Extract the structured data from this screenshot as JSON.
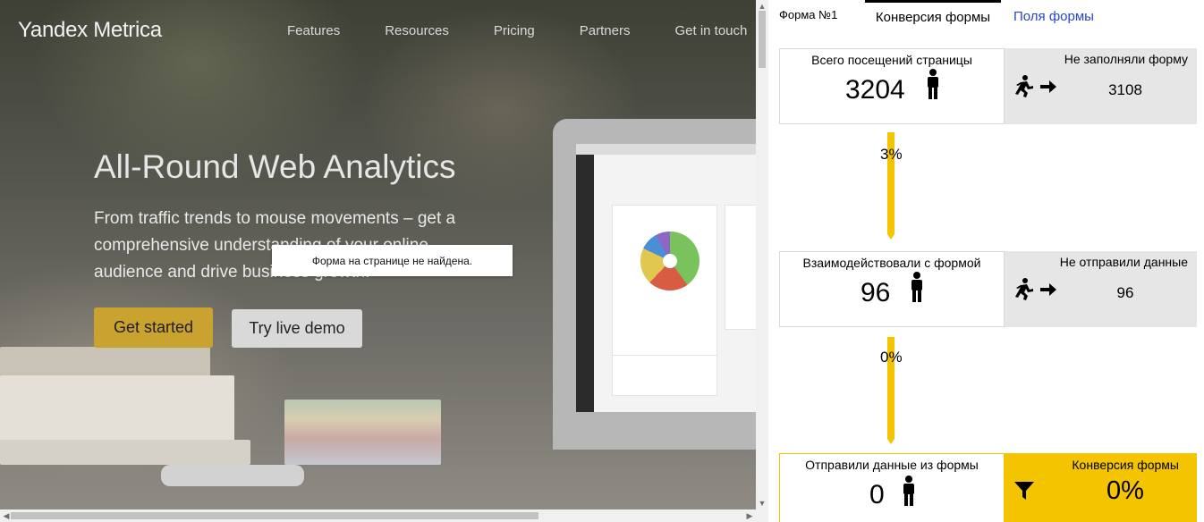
{
  "site": {
    "logo_brand": "Yandex",
    "logo_product": "Metrica",
    "nav": [
      "Features",
      "Resources",
      "Pricing",
      "Partners",
      "Get in touch"
    ],
    "hero_title": "All-Round Web Analytics",
    "hero_subtitle": "From traffic trends to mouse movements – get a comprehensive understanding of your online audience and drive business growth.",
    "get_started": "Get started",
    "try_demo": "Try live demo",
    "notice": "Форма на странице не найдена."
  },
  "panel": {
    "form_name": "Форма №1",
    "tab_active": "Конверсия формы",
    "tab_link": "Поля формы",
    "steps": [
      {
        "title": "Всего посещений страницы",
        "value": "3204",
        "drop_title": "Не заполняли форму",
        "drop_value": "3108"
      },
      {
        "title": "Взаимодействовали с формой",
        "value": "96",
        "drop_title": "Не отправили данные",
        "drop_value": "96"
      },
      {
        "title": "Отправили данные из формы",
        "value": "0"
      }
    ],
    "step_percents": [
      "3%",
      "0%"
    ],
    "conversion_title": "Конверсия формы",
    "conversion_value": "0%"
  },
  "colors": {
    "accent_yellow": "#f5c400",
    "link_blue": "#2846c8",
    "cta_gold": "#c9a22f"
  },
  "icons": [
    "person-icon",
    "runner-arrow-icon",
    "funnel-icon",
    "scroll-arrow-icon"
  ]
}
